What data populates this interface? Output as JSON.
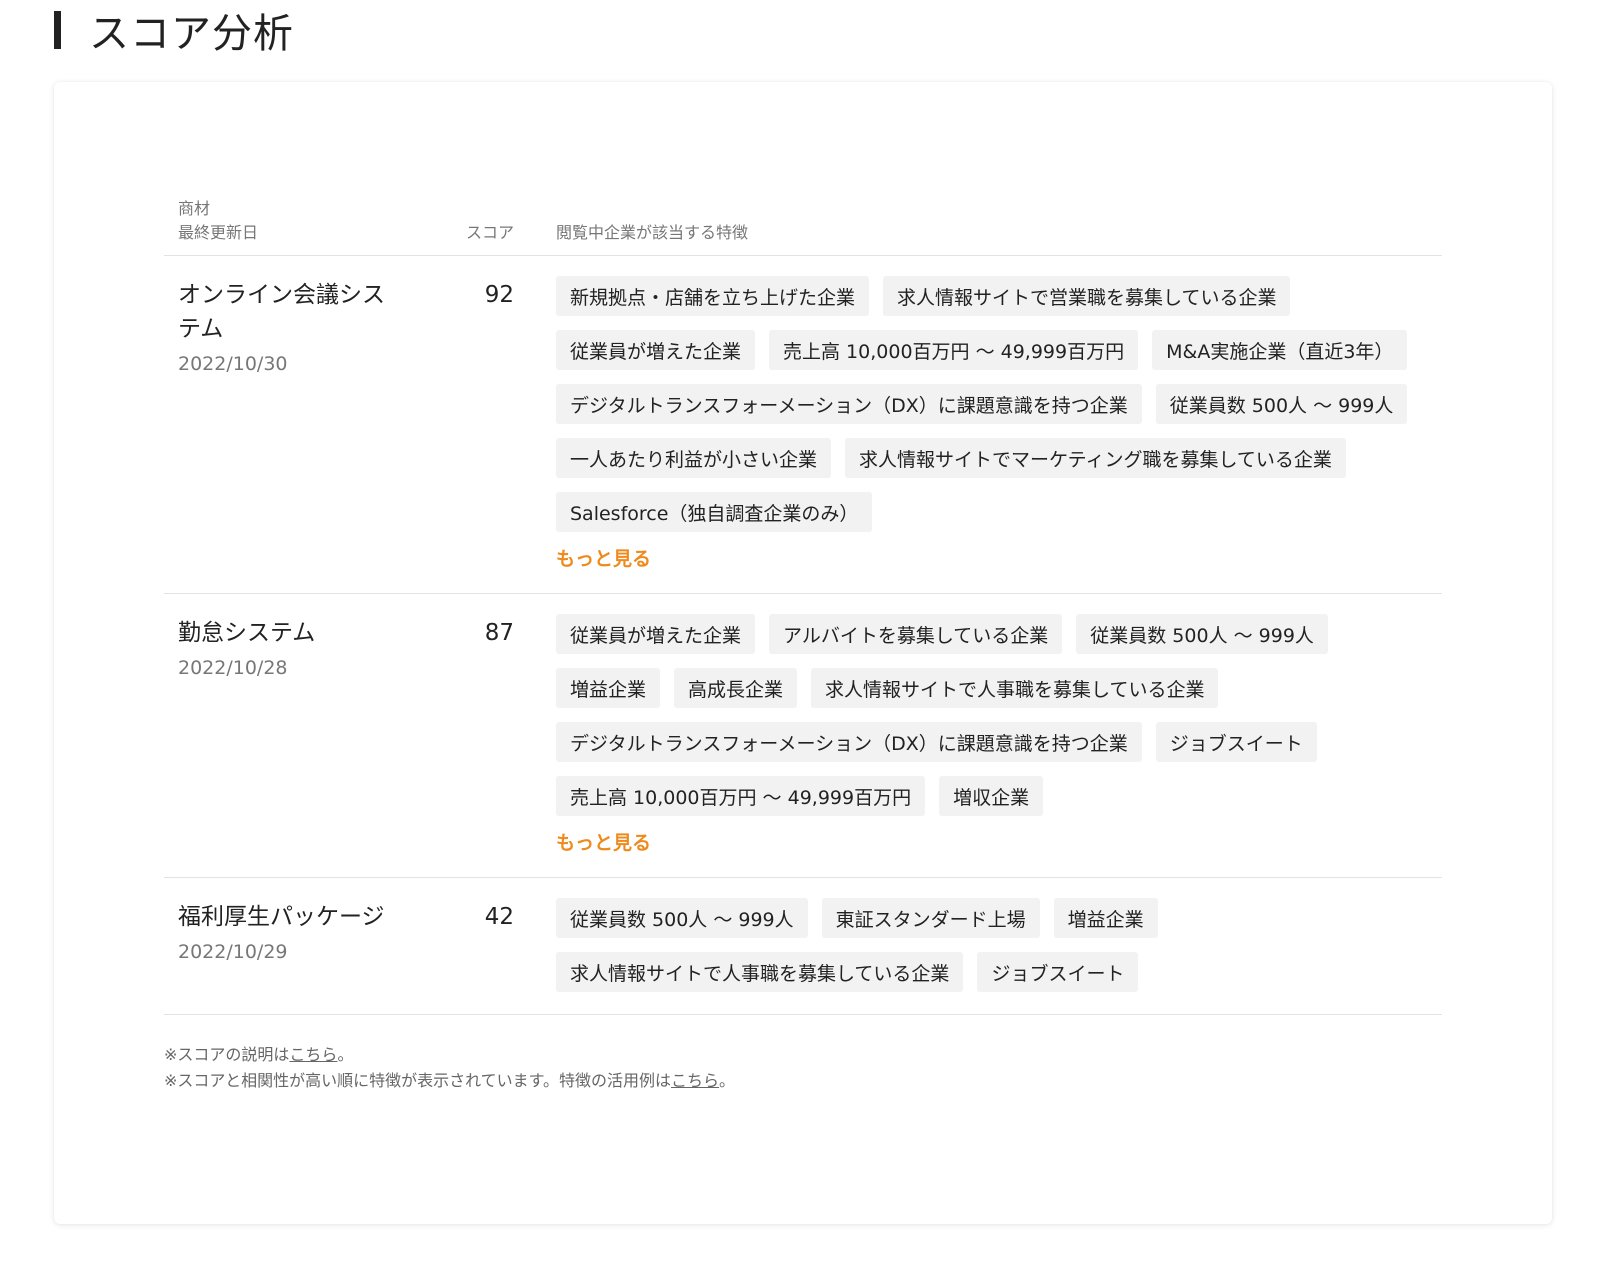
{
  "header": {
    "title": "スコア分析"
  },
  "table": {
    "col_product": "商材",
    "col_updated": "最終更新日",
    "col_score": "スコア",
    "col_features": "閲覧中企業が該当する特徴",
    "rows": [
      {
        "name": "オンライン会議システム",
        "date": "2022/10/30",
        "score": "92",
        "tags": [
          "新規拠点・店舗を立ち上げた企業",
          "求人情報サイトで営業職を募集している企業",
          "従業員が増えた企業",
          "売上高 10,000百万円 〜 49,999百万円",
          "M&A実施企業（直近3年）",
          "デジタルトランスフォーメーション（DX）に課題意識を持つ企業",
          "従業員数 500人 〜 999人",
          "一人あたり利益が小さい企業",
          "求人情報サイトでマーケティング職を募集している企業",
          "Salesforce（独自調査企業のみ）"
        ],
        "more": "もっと見る"
      },
      {
        "name": "勤怠システム",
        "date": "2022/10/28",
        "score": "87",
        "tags": [
          "従業員が増えた企業",
          "アルバイトを募集している企業",
          "従業員数 500人 〜 999人",
          "増益企業",
          "高成長企業",
          "求人情報サイトで人事職を募集している企業",
          "デジタルトランスフォーメーション（DX）に課題意識を持つ企業",
          "ジョブスイート",
          "売上高 10,000百万円 〜 49,999百万円",
          "増収企業"
        ],
        "more": "もっと見る"
      },
      {
        "name": "福利厚生パッケージ",
        "date": "2022/10/29",
        "score": "42",
        "tags": [
          "従業員数 500人 〜 999人",
          "東証スタンダード上場",
          "増益企業",
          "求人情報サイトで人事職を募集している企業",
          "ジョブスイート"
        ],
        "more": ""
      }
    ]
  },
  "notes": {
    "line1_prefix": "※スコアの説明は",
    "line1_link": "こちら",
    "line1_suffix": "。",
    "line2_prefix": "※スコアと相関性が高い順に特徴が表示されています。特徴の活用例は",
    "line2_link": "こちら",
    "line2_suffix": "。"
  },
  "colors": {
    "accent": "#ee8b1c",
    "tag_bg": "#f2f2f2",
    "divider": "#e3e3e3"
  }
}
